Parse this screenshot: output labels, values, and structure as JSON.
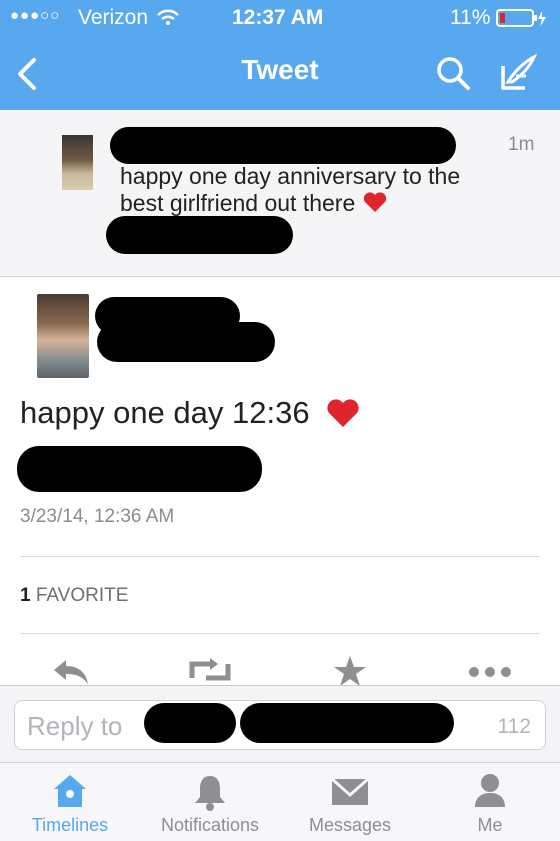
{
  "status_bar": {
    "carrier": "Verizon",
    "time": "12:37 AM",
    "battery": "11%"
  },
  "nav": {
    "title": "Tweet",
    "back_icon": "chevron-left-icon",
    "search_icon": "search-icon",
    "compose_icon": "compose-icon"
  },
  "reply_tweet": {
    "age": "1m",
    "text": "happy one day anniversary to the best girlfriend out there"
  },
  "main_tweet": {
    "text": "happy one day 12:36",
    "timestamp": "3/23/14, 12:36 AM",
    "favorites_count": "1",
    "favorites_label": "FAVORITE"
  },
  "actions": [
    "reply-icon",
    "retweet-icon",
    "favorite-icon",
    "more-icon"
  ],
  "reply_box": {
    "placeholder": "Reply to",
    "char_count": "112"
  },
  "tabbar": {
    "items": [
      {
        "label": "Timelines",
        "icon": "home-icon"
      },
      {
        "label": "Notifications",
        "icon": "bell-icon"
      },
      {
        "label": "Messages",
        "icon": "envelope-icon"
      },
      {
        "label": "Me",
        "icon": "person-icon"
      }
    ]
  },
  "colors": {
    "brand": "#57a8ee",
    "heart": "#e0242c"
  }
}
